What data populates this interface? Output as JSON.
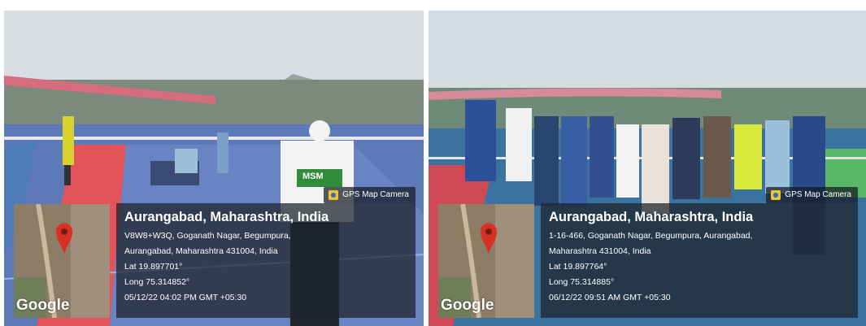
{
  "photos": [
    {
      "badge": "GPS Map Camera",
      "map_logo": "Google",
      "location": "Aurangabad, Maharashtra, India",
      "address_line1": "V8W8+W3Q, Goganath Nagar, Begumpura,",
      "address_line2": "Aurangabad, Maharashtra 431004, India",
      "lat": "Lat 19.897701°",
      "long": "Long 75.314852°",
      "datetime": "05/12/22 04:02 PM GMT +05:30",
      "shirt_text": "MSM",
      "pin_color": "#d93025"
    },
    {
      "badge": "GPS Map Camera",
      "map_logo": "Google",
      "location": "Aurangabad, Maharashtra, India",
      "address_line1": "1-16-466, Goganath Nagar, Begumpura, Aurangabad,",
      "address_line2": "Maharashtra 431004, India",
      "lat": "Lat 19.897764°",
      "long": "Long 75.314885°",
      "datetime": "06/12/22 09:51 AM GMT +05:30",
      "pin_color": "#d93025"
    }
  ]
}
